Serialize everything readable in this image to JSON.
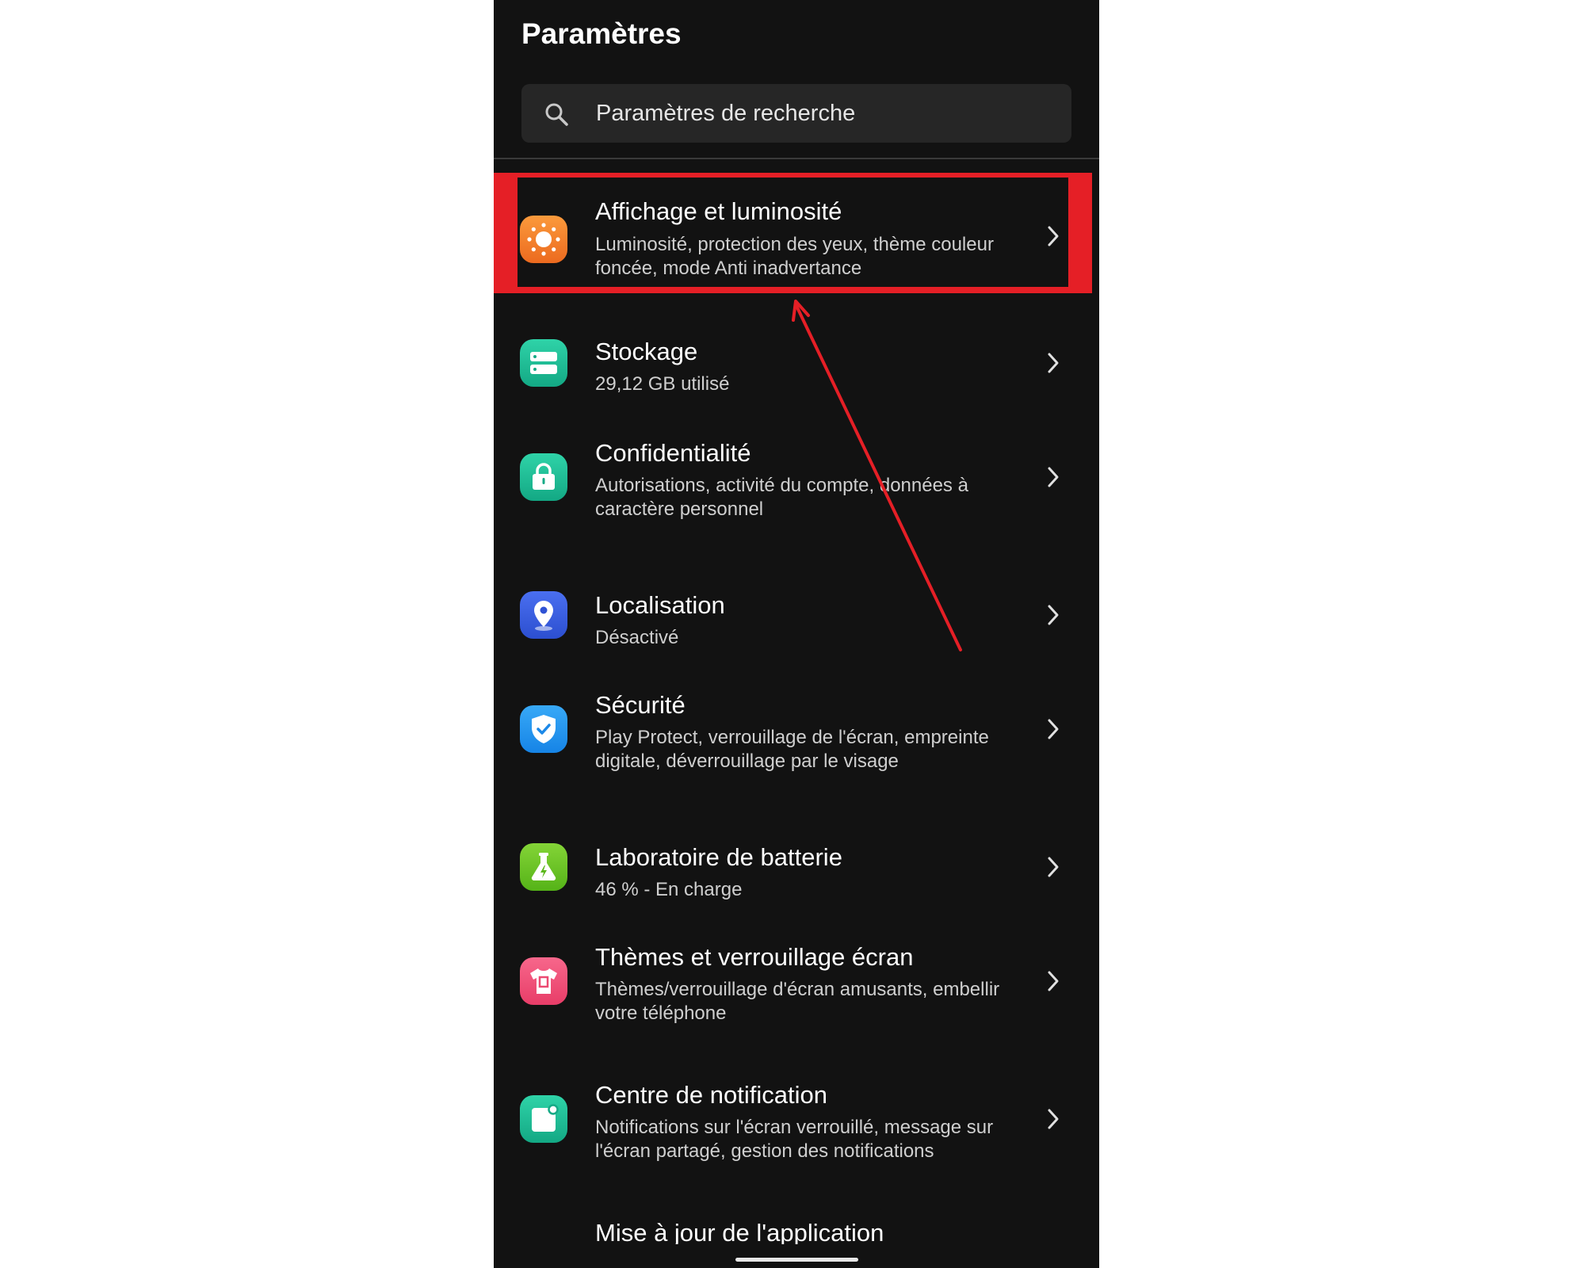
{
  "header": {
    "title": "Paramètres"
  },
  "search": {
    "placeholder": "Paramètres de recherche"
  },
  "items": [
    {
      "title": "Affichage et luminosité",
      "subtitle": "Luminosité, protection des yeux, thème couleur foncée, mode Anti inadvertance",
      "icon": "brightness-icon",
      "highlighted": true
    },
    {
      "title": "Stockage",
      "subtitle": "29,12 GB utilisé",
      "icon": "storage-icon"
    },
    {
      "title": "Confidentialité",
      "subtitle": "Autorisations, activité du compte, données à caractère personnel",
      "icon": "lock-icon"
    },
    {
      "title": "Localisation",
      "subtitle": "Désactivé",
      "icon": "location-pin-icon"
    },
    {
      "title": "Sécurité",
      "subtitle": "Play Protect, verrouillage de l'écran, empreinte digitale, déverrouillage par le visage",
      "icon": "shield-icon"
    },
    {
      "title": "Laboratoire de batterie",
      "subtitle": "46 % - En charge",
      "icon": "battery-lab-icon"
    },
    {
      "title": "Thèmes et verrouillage écran",
      "subtitle": "Thèmes/verrouillage d'écran amusants, embellir votre téléphone",
      "icon": "theme-shirt-icon"
    },
    {
      "title": "Centre de notification",
      "subtitle": "Notifications sur l'écran verrouillé, message sur l'écran partagé, gestion des notifications",
      "icon": "notification-icon"
    },
    {
      "title": "Mise à jour de l'application",
      "subtitle": "",
      "icon": ""
    }
  ],
  "colors": {
    "background": "#121212",
    "highlight": "#e51f26",
    "orange": "#f07a2a",
    "teal": "#1fbf9a",
    "blue": "#3b5fe0",
    "light_blue": "#2196f3",
    "green": "#6cc223",
    "pink": "#f0537a"
  }
}
